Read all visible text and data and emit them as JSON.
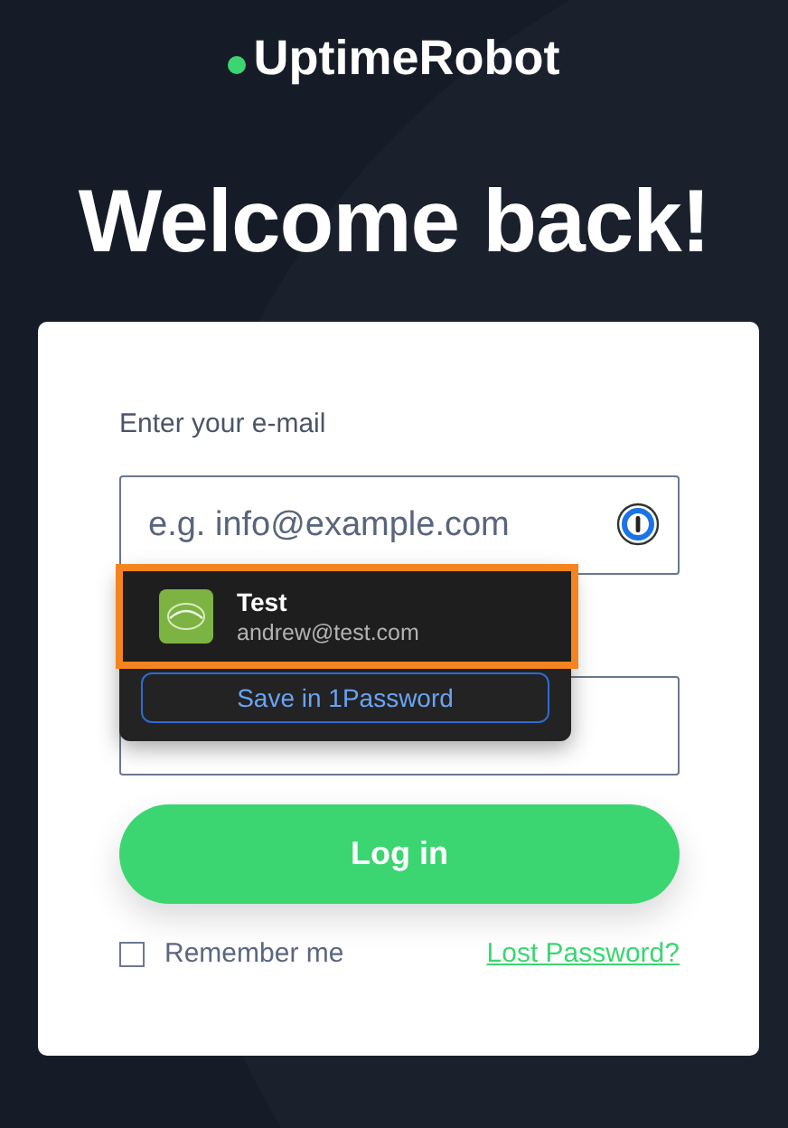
{
  "brand": {
    "name": "UptimeRobot"
  },
  "heading": "Welcome back!",
  "form": {
    "email_label": "Enter your e-mail",
    "email_placeholder": "e.g. info@example.com",
    "login_button": "Log in",
    "remember_me": {
      "label": "Remember me",
      "checked": false
    },
    "lost_password_link": "Lost Password?"
  },
  "autofill_popup": {
    "items": [
      {
        "title": "Test",
        "subtitle": "andrew@test.com",
        "selected": true
      }
    ],
    "save_button": "Save in 1Password"
  }
}
